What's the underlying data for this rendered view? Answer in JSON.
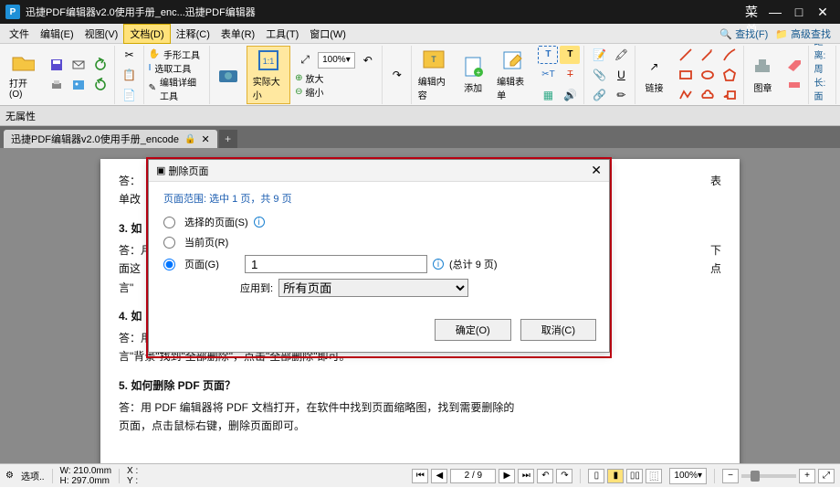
{
  "titlebar": {
    "logo_letter": "P",
    "title": "迅捷PDF编辑器v2.0使用手册_enc...迅捷PDF编辑器",
    "menu_label": "三 菜单"
  },
  "menubar": {
    "items": [
      "文件",
      "编辑(E)",
      "视图(V)",
      "文档(D)",
      "注释(C)",
      "表单(R)",
      "工具(T)",
      "窗口(W)"
    ],
    "active_index": 3,
    "search_label": "查找(F)",
    "advanced_search_label": "高级查找"
  },
  "toolbar": {
    "open_label": "打开(O)",
    "actual_size_label": "实际大小",
    "hand_tool_label": "手形工具",
    "select_tool_label": "选取工具",
    "edit_detail_label": "编辑详细工具",
    "zoom_value": "100%",
    "zoom_in_label": "放大",
    "zoom_out_label": "缩小",
    "edit_content_label": "编辑内容",
    "add_label": "添加",
    "edit_form_label": "编辑表单",
    "link_label": "链接",
    "image_label": "图章",
    "dist_label": "距离:",
    "perim_label": "周长:",
    "area_label": "面积:"
  },
  "panel": {
    "no_attr": "无属性"
  },
  "tab": {
    "name": "迅捷PDF编辑器v2.0使用手册_encode"
  },
  "doc": {
    "p0": "答：",
    "p0b": "表",
    "p1": "单改",
    "h1": "3. 如",
    "p2a": "答：月",
    "p2b": "下",
    "p3a": "面这",
    "p3b": "点",
    "p4": "言\"",
    "h2": "4. 如",
    "p5": "答：用 PDF 编辑器打开文档，选择 \"文档\" 选项，找到 \"页面\" 选项，点",
    "p6": "言\"背景\"找到\"全部删除\"，点击\"全部删除\"即可。",
    "h3": "5. 如何删除 PDF 页面？",
    "p7": "答：用 PDF 编辑器将 PDF 文档打开，在软件中找到页面缩略图，找到需要删除的",
    "p8": "页面，点击鼠标右键，删除页面即可。"
  },
  "dialog": {
    "title": "删除页面",
    "range_label": "页面范围: 选中 1 页，共 9 页",
    "opt_selected": "选择的页面(S)",
    "opt_current": "当前页(R)",
    "opt_pages": "页面(G)",
    "page_value": "1",
    "total_hint": "(总计 9 页)",
    "apply_to_label": "应用到:",
    "apply_to_value": "所有页面",
    "ok": "确定(O)",
    "cancel": "取消(C)"
  },
  "status": {
    "options": "选项..",
    "w_label": "W:",
    "w_value": "210.0mm",
    "h_label": "H:",
    "297": "297.0mm",
    "x_label": "X :",
    "y_label": "Y :",
    "page_display": "2 / 9",
    "zoom": "100%"
  }
}
